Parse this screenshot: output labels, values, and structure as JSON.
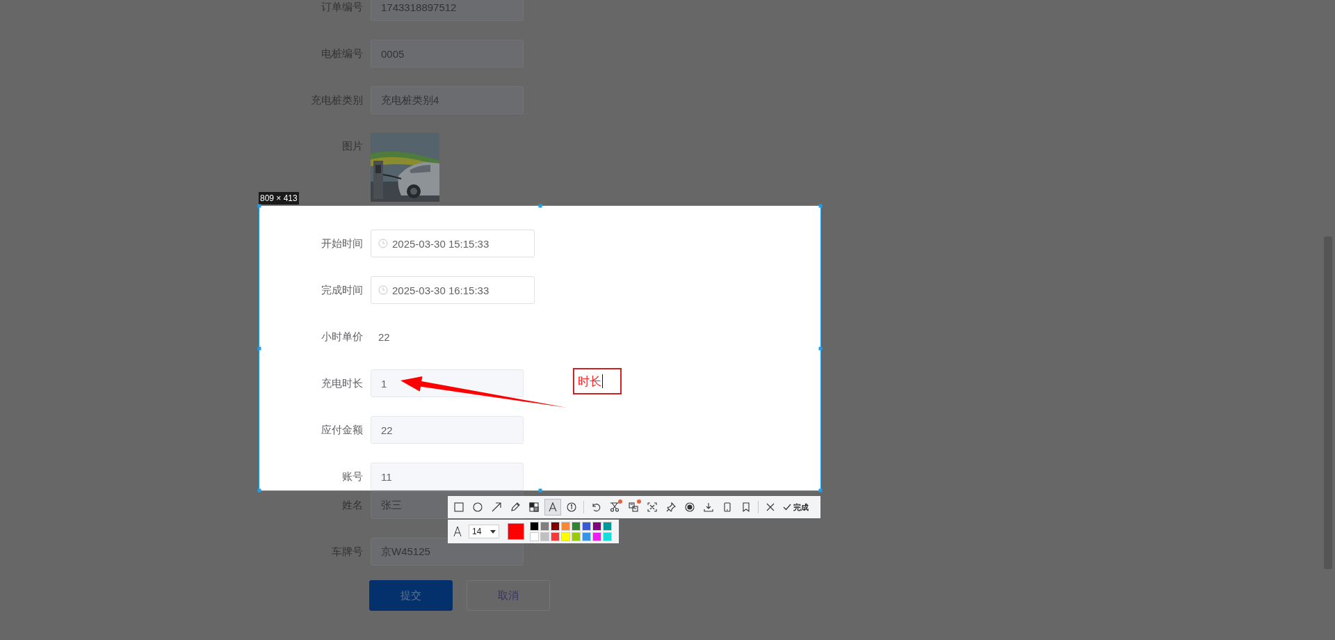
{
  "form_top": [
    {
      "label": "订单编号",
      "kind": "input",
      "value": "1743318897512"
    },
    {
      "label": "电桩编号",
      "kind": "input",
      "value": "0005"
    },
    {
      "label": "充电桩类别",
      "kind": "input",
      "value": "充电桩类别4"
    },
    {
      "label": "图片"
    }
  ],
  "size_label": "809 × 413",
  "form_selected": [
    {
      "label": "开始时间",
      "kind": "datetime",
      "value": "2025-03-30 15:15:33"
    },
    {
      "label": "完成时间",
      "kind": "datetime",
      "value": "2025-03-30 16:15:33"
    },
    {
      "label": "小时单价",
      "kind": "text",
      "value": "22"
    },
    {
      "label": "充电时长",
      "kind": "input",
      "value": "1"
    },
    {
      "label": "应付金额",
      "kind": "input",
      "value": "22"
    },
    {
      "label": "账号",
      "kind": "input",
      "value": "11"
    }
  ],
  "annotation": {
    "text": "时长"
  },
  "form_bottom": [
    {
      "label": "姓名",
      "kind": "input",
      "value": "张三"
    },
    {
      "label": "车牌号",
      "kind": "input",
      "value": "京W45125"
    }
  ],
  "buttons": [
    {
      "label": "提交",
      "kind": "primary"
    },
    {
      "label": "取消",
      "kind": "default"
    }
  ],
  "toolbar": {
    "tools": [
      {
        "kind": "rect",
        "selected": false,
        "dot": false
      },
      {
        "kind": "ellipse",
        "selected": false,
        "dot": false
      },
      {
        "kind": "arrow",
        "selected": false,
        "dot": false
      },
      {
        "kind": "pencil",
        "selected": false,
        "dot": false
      },
      {
        "kind": "mosaic",
        "selected": false,
        "dot": false
      },
      {
        "kind": "text",
        "selected": true,
        "dot": false
      },
      {
        "kind": "number",
        "selected": false,
        "dot": false
      },
      {
        "kind": "sep"
      },
      {
        "kind": "undo",
        "selected": false,
        "dot": false
      },
      {
        "kind": "scissors",
        "selected": false,
        "dot": true
      },
      {
        "kind": "translate",
        "selected": false,
        "dot": true
      },
      {
        "kind": "scan",
        "selected": false,
        "dot": false
      },
      {
        "kind": "pin",
        "selected": false,
        "dot": false
      },
      {
        "kind": "record",
        "selected": false,
        "dot": false
      },
      {
        "kind": "download",
        "selected": false,
        "dot": false
      },
      {
        "kind": "phone",
        "selected": false,
        "dot": false
      },
      {
        "kind": "bookmark",
        "selected": false,
        "dot": false
      },
      {
        "kind": "sep"
      },
      {
        "kind": "close",
        "selected": false,
        "dot": false
      }
    ],
    "done": "完成",
    "font_size": "14",
    "palette": [
      {
        "color": "#000000"
      },
      {
        "color": "#808080"
      },
      {
        "color": "#800000"
      },
      {
        "color": "#f7883a"
      },
      {
        "color": "#308430"
      },
      {
        "color": "#385ad3"
      },
      {
        "color": "#800080"
      },
      {
        "color": "#009999"
      },
      {
        "color": "#ffffff"
      },
      {
        "color": "#c0c0c0"
      },
      {
        "color": "#fb3838"
      },
      {
        "color": "#ffff00"
      },
      {
        "color": "#99cc00"
      },
      {
        "color": "#3894e4"
      },
      {
        "color": "#f31bf3"
      },
      {
        "color": "#16dcdc"
      }
    ]
  }
}
